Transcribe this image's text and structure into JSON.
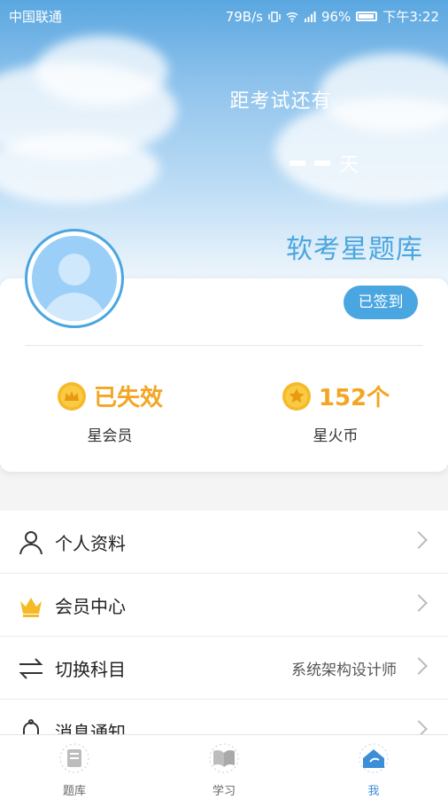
{
  "status_bar": {
    "carrier": "中国联通",
    "net_speed": "79B/s",
    "battery": "96%",
    "time": "下午3:22"
  },
  "header": {
    "countdown_title": "距考试还有",
    "countdown_unit": "天",
    "app_name": "软考星题库"
  },
  "profile": {
    "signin_label": "已签到",
    "stats": [
      {
        "value": "已失效",
        "label": "星会员"
      },
      {
        "value": "152个",
        "label": "星火币"
      }
    ]
  },
  "menu": [
    {
      "label": "个人资料",
      "value": "",
      "icon": "person-icon"
    },
    {
      "label": "会员中心",
      "value": "",
      "icon": "crown-icon"
    },
    {
      "label": "切换科目",
      "value": "系统架构设计师",
      "icon": "swap-icon"
    },
    {
      "label": "消息通知",
      "value": "",
      "icon": "bell-icon"
    }
  ],
  "tabs": [
    {
      "label": "题库",
      "active": false
    },
    {
      "label": "学习",
      "active": false
    },
    {
      "label": "我",
      "active": true
    }
  ],
  "colors": {
    "accent": "#4aa6e0",
    "gold": "#f3a623",
    "tab_active": "#3c8ed6"
  }
}
